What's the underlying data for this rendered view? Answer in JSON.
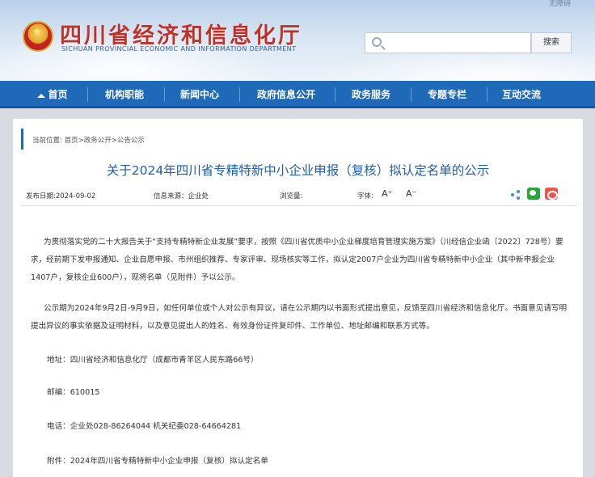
{
  "header": {
    "top_link": "无障碍",
    "site_title": "四川省经济和信息化厅",
    "site_subtitle": "SICHUAN PROVINCIAL ECONOMIC AND INFORMATION DEPARTMENT",
    "search_placeholder": "",
    "search_button": "搜索"
  },
  "nav": {
    "items": [
      "首页",
      "机构职能",
      "新闻中心",
      "政府信息公开",
      "政务服务",
      "专题专栏",
      "互动交流"
    ]
  },
  "breadcrumb": {
    "label": "当前位置:",
    "path": "首页>政务公开>公告公示"
  },
  "article": {
    "title": "关于2024年四川省专精特新中小企业申报（复核）拟认定名单的公示",
    "publish_date": "发布日期:2024-09-02",
    "source": "信息来源：企业处",
    "views": "浏览量:",
    "font_label": "字体:",
    "font_increase": "A⁺",
    "font_decrease": "A⁻",
    "paragraphs": [
      "为贯彻落实党的二十大报告关于“支持专精特新企业发展”要求，按照《四川省优质中小企业梯度培育管理实施方案》（川经信企业函〔2022〕728号）要求，经前期下发申报通知、企业自愿申报、市州组织推荐、专家评审、现场核实等工作，拟认定2007户企业为四川省专精特新中小企业（其中新申报企业1407户，复核企业600户），现将名单（见附件）予以公示。",
      "公示期为2024年9月2日-9月9日，如任何单位或个人对公示有异议，请在公示期内以书面形式提出意见，反馈至四川省经济和信息化厅。书面意见请写明提出异议的事实依据及证明材料，以及意见提出人的姓名、有效身份证件复印件、工作单位、地址邮编和联系方式等。"
    ],
    "address": "地址：四川省经济和信息化厅（成都市青羊区人民东路66号）",
    "postcode": "邮编：610015",
    "phone": "电话：企业处028-86264044   机关纪委028-64664281",
    "attachment": "附件：2024年四川省专精特新中小企业申报（复核）拟认定名单"
  },
  "colors": {
    "brand_red": "#c0312b",
    "nav_blue": "#1f6ab8",
    "title_blue": "#1f5fa8"
  }
}
